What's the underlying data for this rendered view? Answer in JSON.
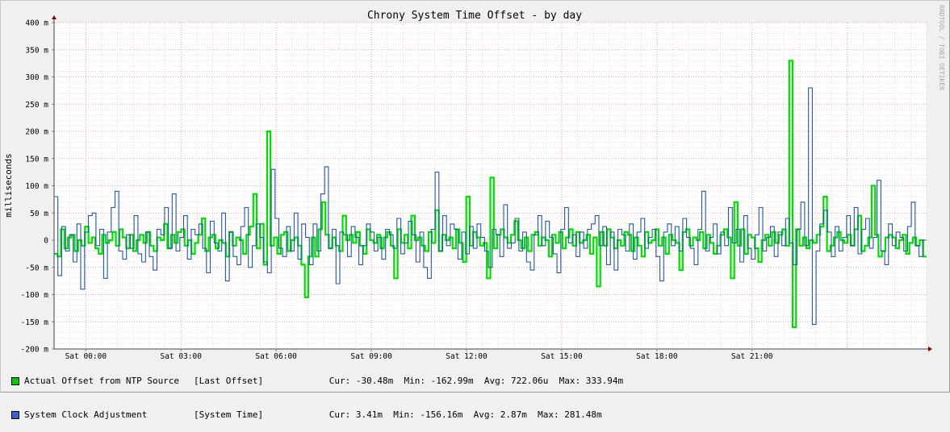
{
  "chart_data": {
    "type": "line",
    "title": "Chrony System Time Offset - by day",
    "ylabel": "milliseconds",
    "watermark": "RRDTOOL / TOBI OETIKER",
    "ylim": [
      -200,
      400
    ],
    "xlim_hours": [
      -1,
      26.5
    ],
    "y_ticks": [
      {
        "value": 400,
        "label": "400 m"
      },
      {
        "value": 350,
        "label": "350 m"
      },
      {
        "value": 300,
        "label": "300 m"
      },
      {
        "value": 250,
        "label": "250 m"
      },
      {
        "value": 200,
        "label": "200 m"
      },
      {
        "value": 150,
        "label": "150 m"
      },
      {
        "value": 100,
        "label": "100 m"
      },
      {
        "value": 50,
        "label": "50 m"
      },
      {
        "value": 0,
        "label": "0"
      },
      {
        "value": -50,
        "label": "-50 m"
      },
      {
        "value": -100,
        "label": "-100 m"
      },
      {
        "value": -150,
        "label": "-150 m"
      },
      {
        "value": -200,
        "label": "-200 m"
      }
    ],
    "x_ticks": [
      {
        "hour": 0,
        "label": "Sat 00:00"
      },
      {
        "hour": 3,
        "label": "Sat 03:00"
      },
      {
        "hour": 6,
        "label": "Sat 06:00"
      },
      {
        "hour": 9,
        "label": "Sat 09:00"
      },
      {
        "hour": 12,
        "label": "Sat 12:00"
      },
      {
        "hour": 15,
        "label": "Sat 15:00"
      },
      {
        "hour": 18,
        "label": "Sat 18:00"
      },
      {
        "hour": 21,
        "label": "Sat 21:00"
      }
    ],
    "grid": true,
    "series": [
      {
        "name": "Actual Offset from NTP Source",
        "source": "[Last Offset]",
        "color": "#00dd00",
        "legend_color": "#00cc00",
        "stats": {
          "cur": "-30.48m",
          "min": "-162.99m",
          "avg": "722.06u",
          "max": "333.94m"
        },
        "values": [
          -25,
          -30,
          20,
          -15,
          5,
          10,
          -20,
          0,
          -10,
          25,
          -5,
          5,
          -15,
          -25,
          10,
          -5,
          0,
          15,
          -10,
          20,
          5,
          -15,
          10,
          -20,
          0,
          10,
          -5,
          15,
          -10,
          -20,
          5,
          0,
          30,
          -15,
          10,
          -5,
          15,
          20,
          -10,
          0,
          -25,
          -5,
          10,
          40,
          -20,
          5,
          10,
          -15,
          0,
          -5,
          -30,
          15,
          -10,
          5,
          0,
          -25,
          10,
          25,
          85,
          -15,
          30,
          -45,
          200,
          -10,
          5,
          -25,
          10,
          15,
          -20,
          0,
          5,
          -10,
          -45,
          -105,
          -30,
          5,
          -30,
          20,
          70,
          10,
          -15,
          5,
          -10,
          -20,
          45,
          0,
          10,
          -5,
          15,
          -10,
          -25,
          20,
          0,
          -5,
          10,
          -15,
          5,
          15,
          -10,
          -70,
          20,
          -5,
          10,
          -15,
          45,
          0,
          5,
          -10,
          -20,
          15,
          -5,
          55,
          -20,
          10,
          0,
          5,
          -15,
          20,
          -5,
          -40,
          80,
          -10,
          15,
          5,
          -10,
          -5,
          -70,
          115,
          -15,
          10,
          20,
          5,
          -5,
          10,
          35,
          0,
          -15,
          5,
          -20,
          10,
          15,
          -10,
          5,
          0,
          -30,
          10,
          -5,
          15,
          -15,
          5,
          20,
          -10,
          15,
          -5,
          0,
          10,
          -25,
          5,
          -85,
          15,
          -10,
          20,
          5,
          -15,
          0,
          -10,
          15,
          10,
          -20,
          5,
          -10,
          -30,
          15,
          -5,
          0,
          20,
          -10,
          5,
          -25,
          10,
          0,
          -5,
          -55,
          15,
          20,
          -10,
          5,
          0,
          15,
          -15,
          10,
          -5,
          -25,
          -10,
          10,
          20,
          5,
          -70,
          70,
          -10,
          20,
          -25,
          10,
          5,
          -15,
          -40,
          0,
          10,
          -10,
          15,
          -5,
          10,
          20,
          -10,
          330,
          -160,
          20,
          -10,
          5,
          -15,
          0,
          -5,
          10,
          25,
          80,
          -20,
          -10,
          5,
          15,
          0,
          -5,
          10,
          -10,
          20,
          45,
          -20,
          -10,
          5,
          100,
          10,
          -30,
          -20,
          5,
          10,
          5,
          -15,
          0,
          10,
          -25,
          -5,
          5,
          -10,
          0,
          -30
        ]
      },
      {
        "name": "System Clock Adjustment",
        "source": "[System Time]",
        "color": "#2255aa",
        "legend_color": "#3b5fd0",
        "stats": {
          "cur": "3.41m",
          "min": "-156.16m",
          "avg": "2.87m",
          "max": "281.48m"
        },
        "values": [
          80,
          -65,
          25,
          -20,
          10,
          -40,
          30,
          -90,
          15,
          45,
          50,
          -10,
          20,
          -70,
          15,
          60,
          90,
          -20,
          -35,
          10,
          -15,
          45,
          -25,
          -40,
          15,
          -30,
          -55,
          20,
          10,
          60,
          -15,
          85,
          -20,
          5,
          45,
          -35,
          20,
          10,
          30,
          -15,
          -60,
          35,
          -5,
          -20,
          50,
          -75,
          15,
          -30,
          -45,
          25,
          60,
          -50,
          -10,
          30,
          5,
          -40,
          -60,
          130,
          40,
          -15,
          -30,
          25,
          -20,
          50,
          -35,
          30,
          5,
          -45,
          30,
          -20,
          85,
          135,
          -15,
          20,
          -80,
          15,
          10,
          -30,
          25,
          5,
          -45,
          -10,
          30,
          15,
          -20,
          5,
          -35,
          20,
          10,
          -15,
          40,
          -25,
          -5,
          35,
          10,
          -40,
          15,
          -50,
          -70,
          20,
          125,
          -20,
          45,
          -10,
          30,
          20,
          -35,
          15,
          -25,
          25,
          -15,
          30,
          5,
          -20,
          -50,
          20,
          10,
          -30,
          65,
          -15,
          -5,
          40,
          -20,
          15,
          -40,
          -55,
          10,
          45,
          -10,
          35,
          5,
          -25,
          -60,
          20,
          60,
          -5,
          10,
          -30,
          15,
          -15,
          20,
          30,
          45,
          -10,
          25,
          -45,
          15,
          -55,
          20,
          10,
          -20,
          30,
          -35,
          15,
          40,
          -15,
          5,
          20,
          -30,
          -75,
          15,
          30,
          -10,
          25,
          -20,
          40,
          5,
          -15,
          -45,
          20,
          90,
          -20,
          5,
          30,
          -25,
          15,
          -10,
          60,
          -5,
          20,
          -40,
          45,
          -15,
          -35,
          10,
          60,
          -20,
          5,
          25,
          -30,
          15,
          -10,
          40,
          -5,
          -45,
          20,
          70,
          -10,
          280,
          -155,
          -20,
          30,
          55,
          15,
          -30,
          25,
          -20,
          5,
          45,
          -10,
          60,
          -25,
          20,
          40,
          -15,
          5,
          110,
          -20,
          -45,
          30,
          -10,
          15,
          5,
          -20,
          25,
          70,
          -10,
          -30,
          0
        ]
      }
    ]
  },
  "legend_labels": {
    "cur": "Cur:",
    "min": "Min:",
    "avg": "Avg:",
    "max": "Max:"
  }
}
